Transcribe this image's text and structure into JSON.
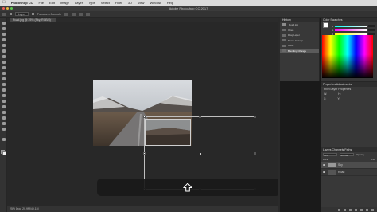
{
  "menubar": {
    "app": "Photoshop CC",
    "items": [
      "File",
      "Edit",
      "Image",
      "Layer",
      "Type",
      "Select",
      "Filter",
      "3D",
      "View",
      "Window",
      "Help"
    ]
  },
  "window": {
    "title": "Adobe Photoshop CC 2017"
  },
  "options_bar": {
    "auto_select_label": "Layer",
    "transform_controls_label": "Transform Controls"
  },
  "document": {
    "tab_label": "Road.jpg @ 25% (Sky, RGB/8) *",
    "status": "25%   Doc: 20.9M/49.1M"
  },
  "history_panel": {
    "tab": "History",
    "snapshot": "Road.jpg",
    "items": [
      "Open",
      "Drag Layer",
      "Name Change",
      "Move",
      "Blending Change"
    ],
    "active_index": 4
  },
  "color_panel": {
    "tabs": "Color   Swatches",
    "channels": [
      "R",
      "G",
      "B"
    ],
    "foreground": "#ffffff",
    "background": "#000000"
  },
  "properties_panel": {
    "tab": "Properties   Adjustments",
    "title": "Pixel Layer Properties",
    "fields": [
      "W:",
      "H:",
      "X:",
      "Y:"
    ]
  },
  "layers_panel": {
    "tabs": "Layers   Channels   Paths",
    "kind": "Kind",
    "blend": "Normal",
    "opacity": "Opacity",
    "lock": "Lock",
    "fill": "Fill",
    "layers": [
      "Sky",
      "Road"
    ],
    "active_index": 0
  },
  "icons": {
    "shift_key": "shift-arrow-icon"
  },
  "colors": {
    "ui_dark": "#282828",
    "panel": "#383838",
    "highlight": "#5b5b5b"
  }
}
